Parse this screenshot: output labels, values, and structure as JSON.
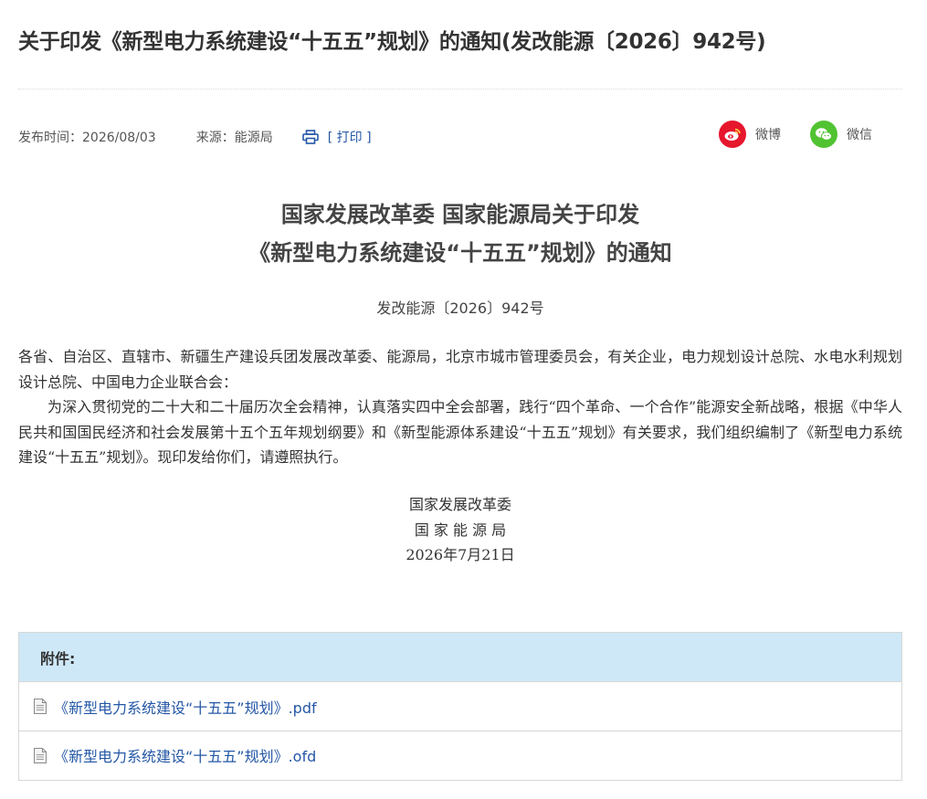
{
  "article": {
    "title": "关于印发《新型电力系统建设“十五五”规划》的通知(发改能源〔2026〕942号)",
    "publish_time": "发布时间：2026/08/03",
    "source": "来源：能源局",
    "print_label": "[ 打印 ]"
  },
  "share": {
    "weibo_label": "微博",
    "wechat_label": "微信"
  },
  "document": {
    "heading_line1": "国家发展改革委 国家能源局关于印发",
    "heading_line2": "《新型电力系统建设“十五五”规划》的通知",
    "doc_number": "发改能源〔2026〕942号",
    "addressees": "各省、自治区、直辖市、新疆生产建设兵团发展改革委、能源局，北京市城市管理委员会，有关企业，电力规划设计总院、水电水利规划设计总院、中国电力企业联合会：",
    "paragraph": "为深入贯彻党的二十大和二十届历次全会精神，认真落实四中全会部署，践行“四个革命、一个合作”能源安全新战略，根据《中华人民共和国国民经济和社会发展第十五个五年规划纲要》和《新型能源体系建设“十五五”规划》有关要求，我们组织编制了《新型电力系统建设“十五五”规划》。现印发给你们，请遵照执行。",
    "signatory_1": "国家发展改革委",
    "signatory_2": "国 家 能 源 局",
    "date": "2026年7月21日"
  },
  "attachments": {
    "header": "附件:",
    "items": [
      "《新型电力系统建设“十五五”规划》.pdf",
      "《新型电力系统建设“十五五”规划》.ofd"
    ]
  },
  "colors": {
    "link": "#2457a6",
    "weibo": "#e6162d",
    "wechat": "#51c332",
    "attachment_header_bg": "#cfe8f8"
  },
  "icons": [
    "print-icon",
    "weibo-icon",
    "wechat-icon",
    "file-icon"
  ]
}
